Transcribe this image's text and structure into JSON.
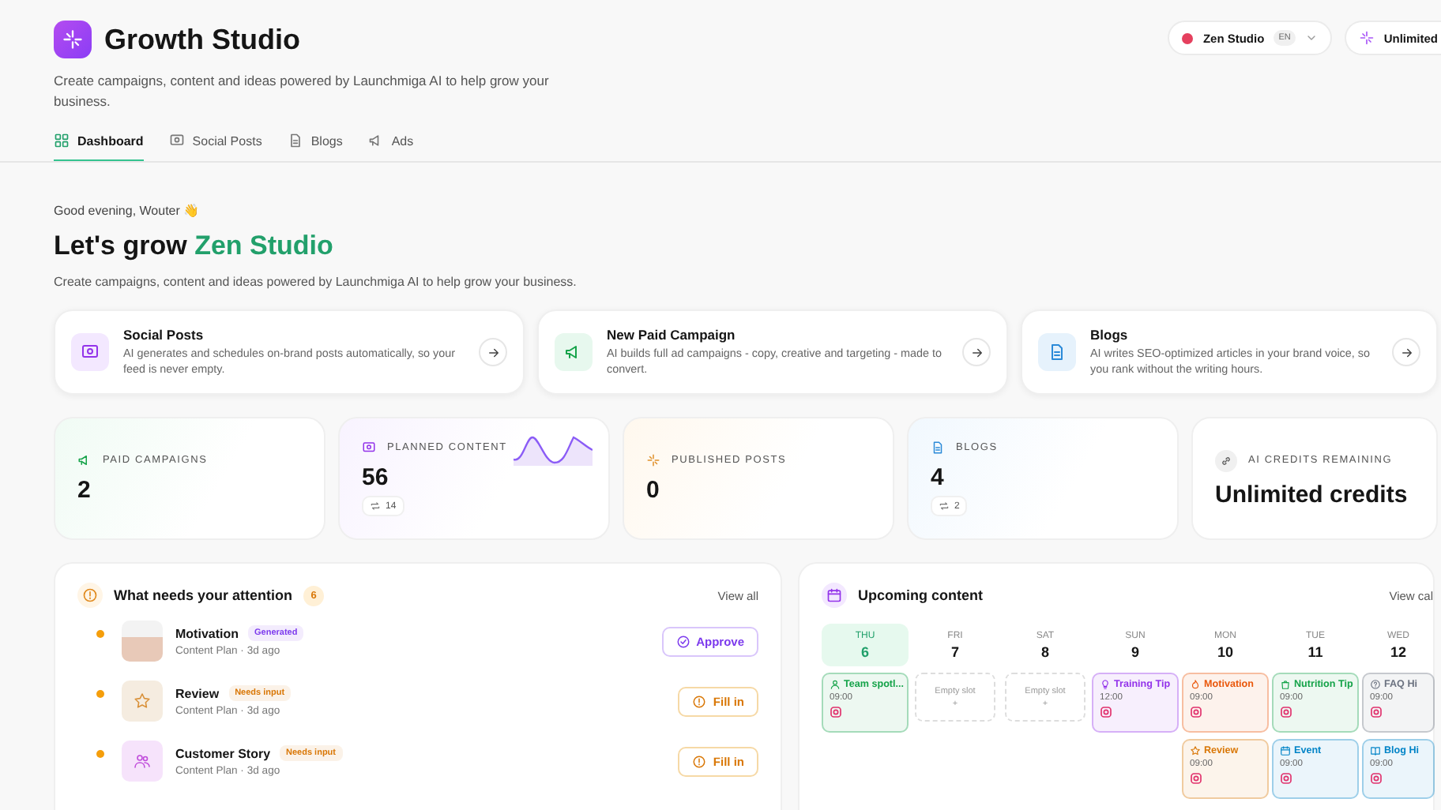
{
  "header": {
    "title": "Growth Studio",
    "subtitle": "Create campaigns, content and ideas powered by Launchmiga AI to help grow your business.",
    "tabs": [
      {
        "label": "Dashboard",
        "kind": "grid",
        "selected": true
      },
      {
        "label": "Social Posts",
        "kind": "chat",
        "selected": false
      },
      {
        "label": "Blogs",
        "kind": "doc",
        "selected": false
      },
      {
        "label": "Ads",
        "kind": "megaphone",
        "selected": false
      }
    ],
    "workspace": {
      "name": "Zen Studio",
      "language": "EN",
      "color": "#e5405e"
    },
    "credits_button": "Unlimited"
  },
  "hero": {
    "greeting": "Good evening, Wouter 👋",
    "heading": "Let's grow",
    "heading_highlight": "Zen Studio",
    "subtitle": "Create campaigns, content and ideas powered by Launchmiga AI to help grow your business."
  },
  "features": [
    {
      "kind": "social",
      "title": "Social Posts",
      "description": "AI generates and schedules on-brand posts automatically, so your feed is never empty."
    },
    {
      "kind": "ads",
      "title": "New Paid Campaign",
      "description": "AI builds full ad campaigns - copy, creative and targeting - made to convert."
    },
    {
      "kind": "blogs",
      "title": "Blogs",
      "description": "AI writes SEO-optimized articles in your brand voice, so you rank without the writing hours."
    }
  ],
  "stats": [
    {
      "kind": "ads",
      "label": "PAID CAMPAIGNS",
      "value": "2"
    },
    {
      "kind": "planned",
      "label": "PLANNED CONTENT",
      "value": "56",
      "delta": "14"
    },
    {
      "kind": "published",
      "label": "PUBLISHED POSTS",
      "value": "0"
    },
    {
      "kind": "blogs",
      "label": "BLOGS",
      "value": "4",
      "delta": "2"
    },
    {
      "kind": "credits",
      "label": "AI CREDITS REMAINING",
      "value": "Unlimited credits"
    }
  ],
  "attention": {
    "title": "What needs your attention",
    "count": "6",
    "view_all": "View all",
    "items": [
      {
        "kind": "photo",
        "title": "Motivation",
        "badge": {
          "label": "Generated",
          "color": "#7c3aed"
        },
        "meta": "Content Plan · 3d ago",
        "action": {
          "kind": "approve",
          "label": "Approve"
        }
      },
      {
        "kind": "star",
        "title": "Review",
        "badge": {
          "label": "Needs input",
          "color": "#d97706"
        },
        "meta": "Content Plan · 3d ago",
        "action": {
          "kind": "fill",
          "label": "Fill in"
        }
      },
      {
        "kind": "people",
        "title": "Customer Story",
        "badge": {
          "label": "Needs input",
          "color": "#d97706"
        },
        "meta": "Content Plan · 3d ago",
        "action": {
          "kind": "fill",
          "label": "Fill in"
        }
      }
    ]
  },
  "upcoming": {
    "title": "Upcoming content",
    "view_all": "View cal",
    "days": [
      {
        "weekday": "THU",
        "date": "6",
        "selected": true,
        "events": [
          {
            "kind": "person",
            "title": "Team spotl...",
            "time": "09:00",
            "color": "#16a34a"
          }
        ]
      },
      {
        "weekday": "FRI",
        "date": "7",
        "selected": false,
        "empty": {
          "label": "Empty slot",
          "plus": "+"
        }
      },
      {
        "weekday": "SAT",
        "date": "8",
        "selected": false,
        "empty": {
          "label": "Empty slot",
          "plus": "+"
        }
      },
      {
        "weekday": "SUN",
        "date": "9",
        "selected": false,
        "events": [
          {
            "kind": "bulb",
            "title": "Training Tip",
            "time": "12:00",
            "color": "#9333ea"
          }
        ]
      },
      {
        "weekday": "MON",
        "date": "10",
        "selected": false,
        "events": [
          {
            "kind": "flame",
            "title": "Motivation",
            "time": "09:00",
            "color": "#ea580c"
          },
          {
            "kind": "star",
            "title": "Review",
            "time": "09:00",
            "color": "#d97706"
          }
        ]
      },
      {
        "weekday": "TUE",
        "date": "11",
        "selected": false,
        "events": [
          {
            "kind": "bag",
            "title": "Nutrition Tip",
            "time": "09:00",
            "color": "#16a34a"
          },
          {
            "kind": "calendar",
            "title": "Event",
            "time": "09:00",
            "color": "#0284c7"
          }
        ]
      },
      {
        "weekday": "WED",
        "date": "12",
        "selected": false,
        "events": [
          {
            "kind": "help",
            "title": "FAQ Hi",
            "time": "09:00",
            "color": "#6b7280"
          },
          {
            "kind": "book",
            "title": "Blog Hi",
            "time": "09:00",
            "color": "#0284c7"
          }
        ]
      }
    ]
  }
}
